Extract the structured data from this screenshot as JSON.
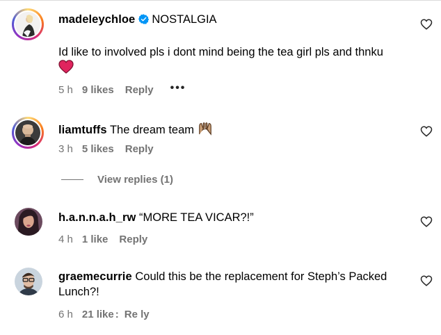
{
  "comments": [
    {
      "username": "madeleychloe",
      "verified": true,
      "text": "NOSTALGIA",
      "body": "Id like to involved pls i dont mind being the tea girl pls and thnku",
      "time": "5 h",
      "likes": "9 likes",
      "reply": "Reply",
      "more": "•••"
    },
    {
      "username": "liamtuffs",
      "text": "The dream team",
      "time": "3 h",
      "likes": "5 likes",
      "reply": "Reply",
      "view_replies": "View replies (1)"
    },
    {
      "username": "h.a.n.n.a.h_rw",
      "text": "“MORE TEA VICAR?!”",
      "time": "4 h",
      "likes": "1 like",
      "reply": "Reply"
    },
    {
      "username": "graemecurrie",
      "text": "Could this be the replacement for Steph’s Packed",
      "text_line2": "Lunch?!",
      "time": "6 h",
      "likes": "21 like",
      "reply": "Re",
      "reply_end": "ly"
    }
  ],
  "colors": {
    "meta": "#737373",
    "verified": "#0095f6",
    "heart_emoji": "#e0245e"
  }
}
